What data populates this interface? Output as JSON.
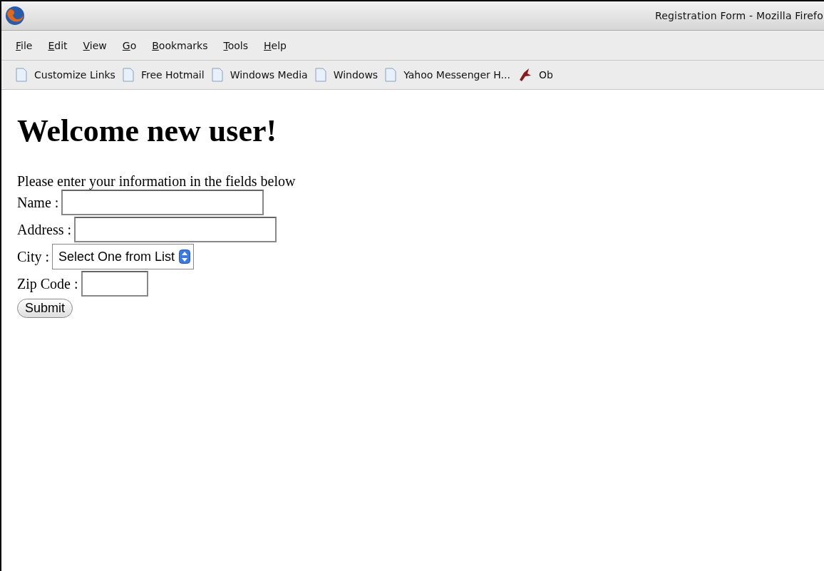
{
  "window": {
    "title": "Registration Form - Mozilla Firefo"
  },
  "menu": [
    {
      "label": "File"
    },
    {
      "label": "Edit"
    },
    {
      "label": "View"
    },
    {
      "label": "Go"
    },
    {
      "label": "Bookmarks"
    },
    {
      "label": "Tools"
    },
    {
      "label": "Help"
    }
  ],
  "bookmarks": [
    {
      "label": "Customize Links",
      "kind": "page"
    },
    {
      "label": "Free Hotmail",
      "kind": "page"
    },
    {
      "label": "Windows Media",
      "kind": "page"
    },
    {
      "label": "Windows",
      "kind": "page"
    },
    {
      "label": "Yahoo Messenger H...",
      "kind": "page"
    },
    {
      "label": "Ob",
      "kind": "feed"
    }
  ],
  "page": {
    "heading": "Welcome new user!",
    "intro": "Please enter your information in the fields below",
    "fields": [
      {
        "label": "Name :",
        "kind": "text"
      },
      {
        "label": "Address :",
        "kind": "text"
      },
      {
        "label": "City :",
        "kind": "select",
        "value": "Select One from List"
      },
      {
        "label": "Zip Code :",
        "kind": "short_text"
      }
    ],
    "submit": "Submit"
  }
}
